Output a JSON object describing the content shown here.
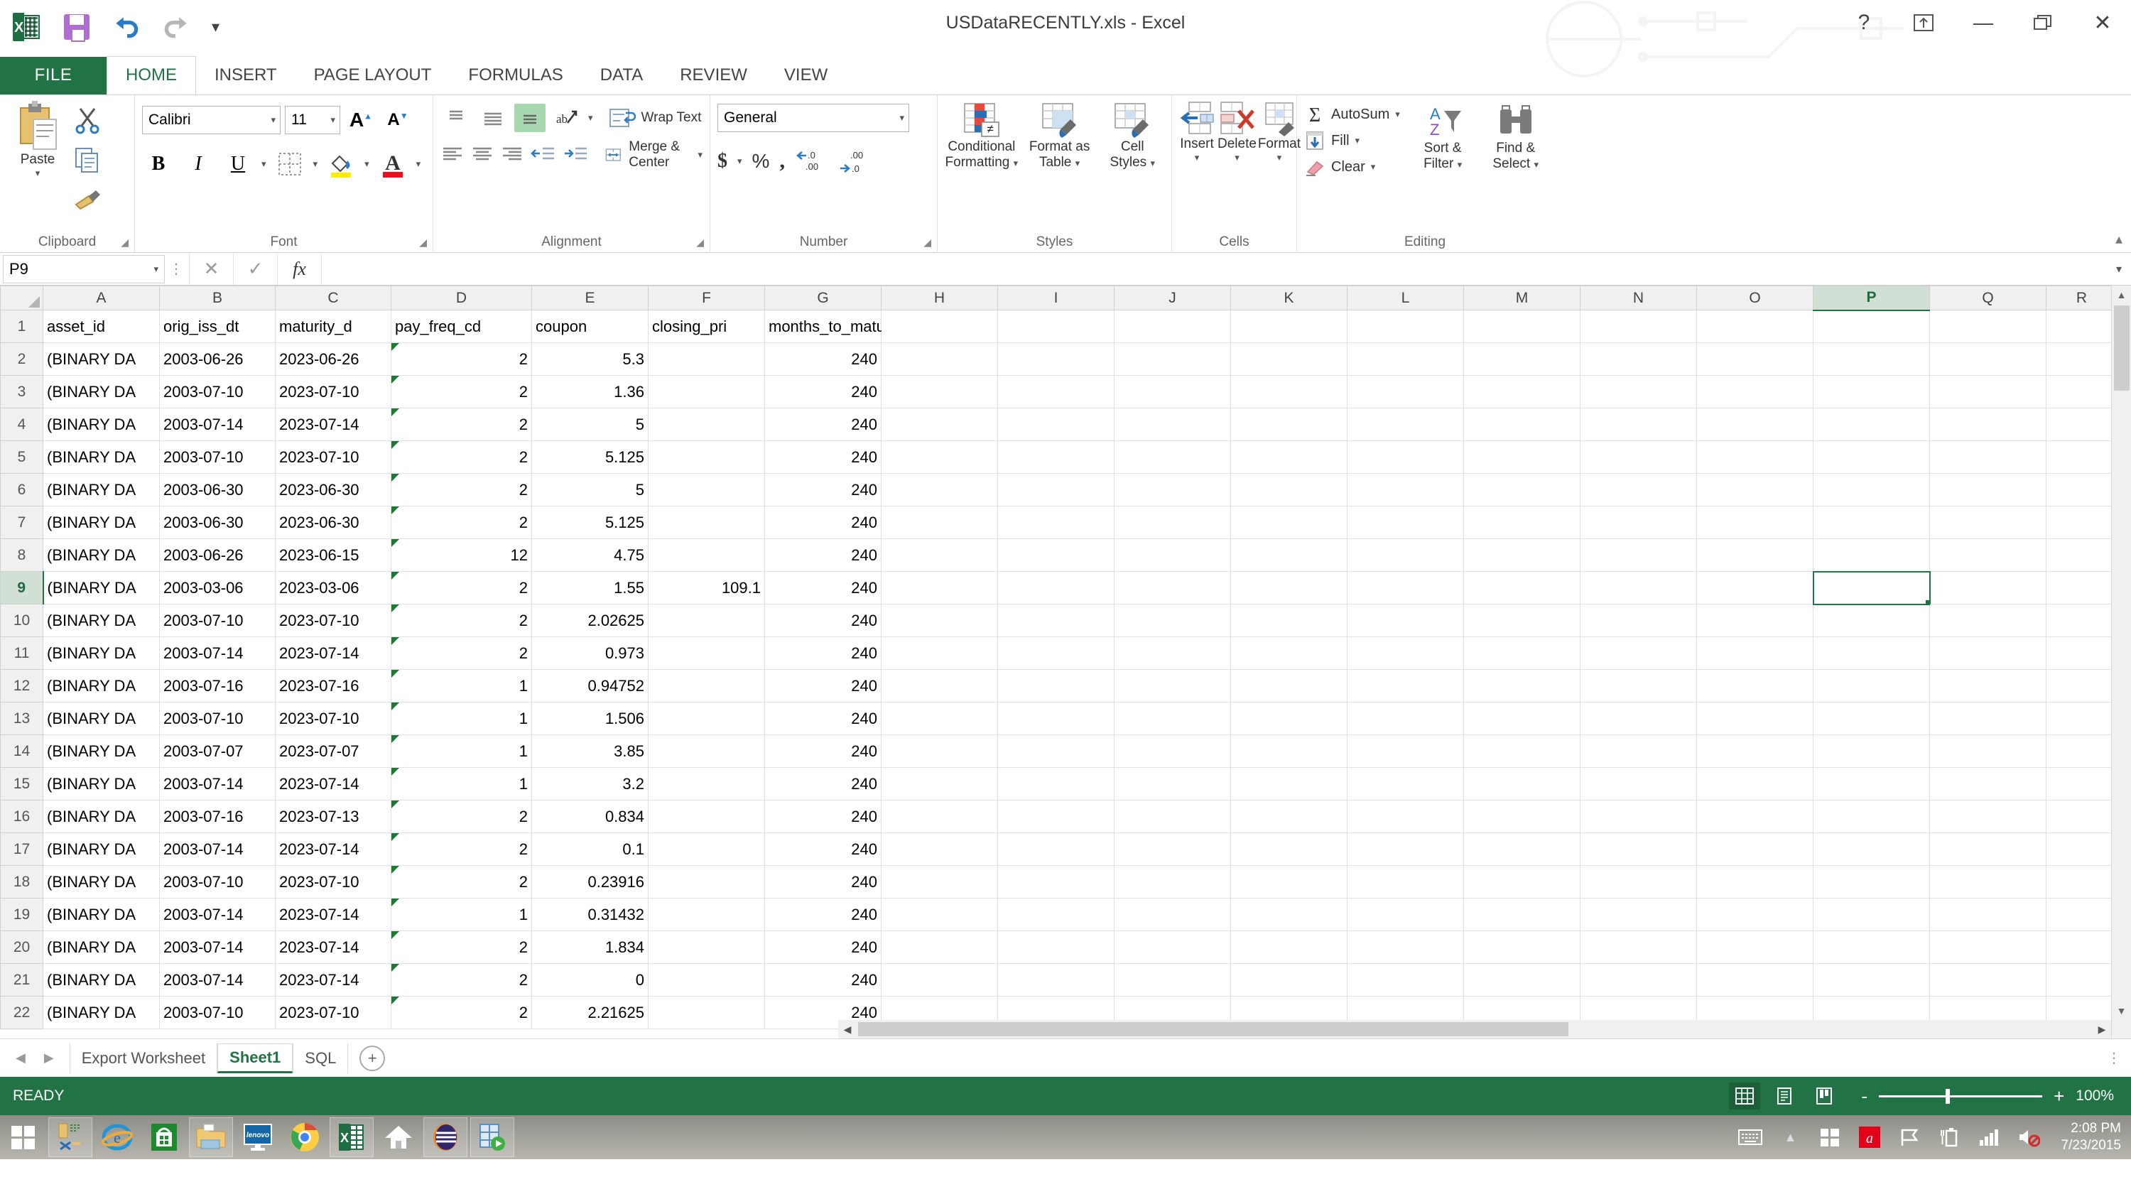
{
  "window": {
    "title": "USDataRECENTLY.xls - Excel",
    "quick_access": [
      {
        "name": "excel-logo",
        "label": "Excel"
      },
      {
        "name": "save-icon",
        "label": "Save"
      },
      {
        "name": "undo-icon",
        "label": "Undo"
      },
      {
        "name": "redo-icon",
        "label": "Redo"
      },
      {
        "name": "customize-qat-icon",
        "label": "Customize Quick Access Toolbar"
      }
    ],
    "controls": [
      {
        "name": "help-button",
        "glyph": "?"
      },
      {
        "name": "ribbon-display-options-button",
        "glyph": "⤒"
      },
      {
        "name": "minimize-button",
        "glyph": "—"
      },
      {
        "name": "restore-button",
        "glyph": "❐"
      },
      {
        "name": "close-button",
        "glyph": "✕"
      }
    ]
  },
  "tabs": {
    "file": "FILE",
    "items": [
      "HOME",
      "INSERT",
      "PAGE LAYOUT",
      "FORMULAS",
      "DATA",
      "REVIEW",
      "VIEW"
    ],
    "active": "HOME"
  },
  "ribbon": {
    "clipboard": {
      "name": "Clipboard",
      "paste": "Paste",
      "cut": "Cut",
      "copy": "Copy",
      "format_painter": "Format Painter"
    },
    "font": {
      "name": "Font",
      "font_family": "Calibri",
      "font_size": "11",
      "grow": "Increase Font Size",
      "shrink": "Decrease Font Size",
      "bold": "B",
      "italic": "I",
      "underline": "U",
      "borders": "Borders",
      "fill_color": "Fill Color",
      "font_color": "Font Color"
    },
    "alignment": {
      "name": "Alignment",
      "top_align": "Top Align",
      "middle_align": "Middle Align",
      "bottom_align": "Bottom Align",
      "orientation": "Orientation",
      "align_left": "Align Left",
      "center": "Center",
      "align_right": "Align Right",
      "decrease_indent": "Decrease Indent",
      "increase_indent": "Increase Indent",
      "wrap_text": "Wrap Text",
      "merge_center": "Merge & Center"
    },
    "number": {
      "name": "Number",
      "format": "General",
      "accounting": "$",
      "percent": "%",
      "comma": ",",
      "increase_decimal": "Increase Decimal",
      "decrease_decimal": "Decrease Decimal"
    },
    "styles": {
      "name": "Styles",
      "conditional_formatting": "Conditional\nFormatting",
      "conditional_formatting_l1": "Conditional",
      "conditional_formatting_l2": "Formatting",
      "format_as_table_l1": "Format as",
      "format_as_table_l2": "Table",
      "cell_styles_l1": "Cell",
      "cell_styles_l2": "Styles"
    },
    "cells": {
      "name": "Cells",
      "insert": "Insert",
      "delete": "Delete",
      "format": "Format"
    },
    "editing": {
      "name": "Editing",
      "autosum": "AutoSum",
      "fill": "Fill",
      "clear": "Clear",
      "sort_filter_l1": "Sort &",
      "sort_filter_l2": "Filter",
      "find_select_l1": "Find &",
      "find_select_l2": "Select"
    },
    "collapse": "Collapse the Ribbon"
  },
  "formula_bar": {
    "name_box": "P9",
    "cancel": "✕",
    "enter": "✓",
    "insert_function": "fx",
    "value": ""
  },
  "grid": {
    "columns": [
      "A",
      "B",
      "C",
      "D",
      "E",
      "F",
      "G",
      "H",
      "I",
      "J",
      "K",
      "L",
      "M",
      "N",
      "O",
      "P",
      "Q",
      "R"
    ],
    "selected_column": "P",
    "selected_row": 9,
    "selected_cell": "P9",
    "headers": {
      "A": "asset_id",
      "B": "orig_iss_dt",
      "C": "maturity_d",
      "D": "pay_freq_cd",
      "E": "coupon",
      "F": "closing_pri",
      "G": "months_to_maturity"
    },
    "rows": [
      {
        "n": 1,
        "A": "asset_id",
        "B": "orig_iss_dt",
        "C": "maturity_d",
        "D": "pay_freq_cd",
        "E": "coupon",
        "F": "closing_pri",
        "G": "months_to_maturity",
        "err": false,
        "header": true
      },
      {
        "n": 2,
        "A": "(BINARY DA",
        "B": "2003-06-26",
        "C": "2023-06-26",
        "D": "2",
        "E": "5.3",
        "F": "",
        "G": "240",
        "err": true
      },
      {
        "n": 3,
        "A": "(BINARY DA",
        "B": "2003-07-10",
        "C": "2023-07-10",
        "D": "2",
        "E": "1.36",
        "F": "",
        "G": "240",
        "err": true
      },
      {
        "n": 4,
        "A": "(BINARY DA",
        "B": "2003-07-14",
        "C": "2023-07-14",
        "D": "2",
        "E": "5",
        "F": "",
        "G": "240",
        "err": true
      },
      {
        "n": 5,
        "A": "(BINARY DA",
        "B": "2003-07-10",
        "C": "2023-07-10",
        "D": "2",
        "E": "5.125",
        "F": "",
        "G": "240",
        "err": true
      },
      {
        "n": 6,
        "A": "(BINARY DA",
        "B": "2003-06-30",
        "C": "2023-06-30",
        "D": "2",
        "E": "5",
        "F": "",
        "G": "240",
        "err": true
      },
      {
        "n": 7,
        "A": "(BINARY DA",
        "B": "2003-06-30",
        "C": "2023-06-30",
        "D": "2",
        "E": "5.125",
        "F": "",
        "G": "240",
        "err": true
      },
      {
        "n": 8,
        "A": "(BINARY DA",
        "B": "2003-06-26",
        "C": "2023-06-15",
        "D": "12",
        "E": "4.75",
        "F": "",
        "G": "240",
        "err": true
      },
      {
        "n": 9,
        "A": "(BINARY DA",
        "B": "2003-03-06",
        "C": "2023-03-06",
        "D": "2",
        "E": "1.55",
        "F": "109.1",
        "G": "240",
        "err": true
      },
      {
        "n": 10,
        "A": "(BINARY DA",
        "B": "2003-07-10",
        "C": "2023-07-10",
        "D": "2",
        "E": "2.02625",
        "F": "",
        "G": "240",
        "err": true
      },
      {
        "n": 11,
        "A": "(BINARY DA",
        "B": "2003-07-14",
        "C": "2023-07-14",
        "D": "2",
        "E": "0.973",
        "F": "",
        "G": "240",
        "err": true
      },
      {
        "n": 12,
        "A": "(BINARY DA",
        "B": "2003-07-16",
        "C": "2023-07-16",
        "D": "1",
        "E": "0.94752",
        "F": "",
        "G": "240",
        "err": true
      },
      {
        "n": 13,
        "A": "(BINARY DA",
        "B": "2003-07-10",
        "C": "2023-07-10",
        "D": "1",
        "E": "1.506",
        "F": "",
        "G": "240",
        "err": true
      },
      {
        "n": 14,
        "A": "(BINARY DA",
        "B": "2003-07-07",
        "C": "2023-07-07",
        "D": "1",
        "E": "3.85",
        "F": "",
        "G": "240",
        "err": true
      },
      {
        "n": 15,
        "A": "(BINARY DA",
        "B": "2003-07-14",
        "C": "2023-07-14",
        "D": "1",
        "E": "3.2",
        "F": "",
        "G": "240",
        "err": true
      },
      {
        "n": 16,
        "A": "(BINARY DA",
        "B": "2003-07-16",
        "C": "2023-07-13",
        "D": "2",
        "E": "0.834",
        "F": "",
        "G": "240",
        "err": true
      },
      {
        "n": 17,
        "A": "(BINARY DA",
        "B": "2003-07-14",
        "C": "2023-07-14",
        "D": "2",
        "E": "0.1",
        "F": "",
        "G": "240",
        "err": true
      },
      {
        "n": 18,
        "A": "(BINARY DA",
        "B": "2003-07-10",
        "C": "2023-07-10",
        "D": "2",
        "E": "0.23916",
        "F": "",
        "G": "240",
        "err": true
      },
      {
        "n": 19,
        "A": "(BINARY DA",
        "B": "2003-07-14",
        "C": "2023-07-14",
        "D": "1",
        "E": "0.31432",
        "F": "",
        "G": "240",
        "err": true
      },
      {
        "n": 20,
        "A": "(BINARY DA",
        "B": "2003-07-14",
        "C": "2023-07-14",
        "D": "2",
        "E": "1.834",
        "F": "",
        "G": "240",
        "err": true
      },
      {
        "n": 21,
        "A": "(BINARY DA",
        "B": "2003-07-14",
        "C": "2023-07-14",
        "D": "2",
        "E": "0",
        "F": "",
        "G": "240",
        "err": true
      },
      {
        "n": 22,
        "A": "(BINARY DA",
        "B": "2003-07-10",
        "C": "2023-07-10",
        "D": "2",
        "E": "2.21625",
        "F": "",
        "G": "240",
        "err": true
      }
    ]
  },
  "sheet_tabs": {
    "items": [
      "Export Worksheet",
      "Sheet1",
      "SQL"
    ],
    "active": "Sheet1",
    "add_label": "+"
  },
  "status": {
    "text": "READY",
    "views": [
      {
        "name": "normal-view-button",
        "active": true
      },
      {
        "name": "page-layout-view-button",
        "active": false
      },
      {
        "name": "page-break-preview-button",
        "active": false
      }
    ],
    "zoom_out": "-",
    "zoom_in": "+",
    "zoom_level": "100%"
  },
  "taskbar": {
    "start": "start-button",
    "items": [
      {
        "name": "taskbar-item-tools",
        "pinned": true
      },
      {
        "name": "taskbar-item-internet-explorer",
        "pinned": false
      },
      {
        "name": "taskbar-item-store",
        "pinned": false
      },
      {
        "name": "taskbar-item-file-explorer",
        "pinned": true
      },
      {
        "name": "taskbar-item-lenovo",
        "pinned": false
      },
      {
        "name": "taskbar-item-chrome",
        "pinned": false
      },
      {
        "name": "taskbar-item-excel",
        "pinned": true
      },
      {
        "name": "taskbar-item-home",
        "pinned": false
      },
      {
        "name": "taskbar-item-app-oval",
        "pinned": true
      },
      {
        "name": "taskbar-item-database-run",
        "pinned": true
      }
    ],
    "tray": [
      {
        "name": "touch-keyboard-icon"
      },
      {
        "name": "show-hidden-icons-icon"
      },
      {
        "name": "windows-icon"
      },
      {
        "name": "avira-icon"
      },
      {
        "name": "action-center-flag-icon"
      },
      {
        "name": "battery-icon"
      },
      {
        "name": "network-signal-icon"
      },
      {
        "name": "volume-muted-icon"
      }
    ],
    "clock_time": "2:08 PM",
    "clock_date": "7/23/2015"
  },
  "colors": {
    "excel_green": "#217346",
    "ribbon_green_dark": "#1b5e38",
    "selection_green": "#d2dfd4",
    "error_triangle": "#1a7a33"
  }
}
